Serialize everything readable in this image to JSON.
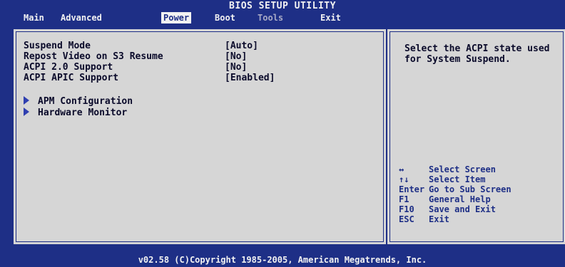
{
  "title": "BIOS SETUP UTILITY",
  "tabs": [
    {
      "label": "Main"
    },
    {
      "label": "Advanced"
    },
    {
      "label": "Power"
    },
    {
      "label": "Boot"
    },
    {
      "label": "Tools"
    },
    {
      "label": "Exit"
    }
  ],
  "active_tab": "Power",
  "settings": [
    {
      "label": "Suspend Mode",
      "value": "[Auto]"
    },
    {
      "label": "Repost Video on S3 Resume",
      "value": "[No]"
    },
    {
      "label": "ACPI 2.0 Support",
      "value": "[No]"
    },
    {
      "label": "ACPI APIC Support",
      "value": "[Enabled]"
    }
  ],
  "submenus": [
    {
      "label": "APM Configuration"
    },
    {
      "label": "Hardware Monitor"
    }
  ],
  "help_text": "Select the ACPI state used for System Suspend.",
  "key_legend": [
    {
      "key": "↔",
      "desc": "Select Screen"
    },
    {
      "key": "↑↓",
      "desc": "Select Item"
    },
    {
      "key": "Enter",
      "desc": "Go to Sub Screen"
    },
    {
      "key": "F1",
      "desc": "General Help"
    },
    {
      "key": "F10",
      "desc": "Save and Exit"
    },
    {
      "key": "ESC",
      "desc": "Exit"
    }
  ],
  "footer": "v02.58 (C)Copyright 1985-2005, American Megatrends, Inc.",
  "colors": {
    "background": "#1e2f86",
    "panel": "#d6d6d6",
    "text": "#0a0a2a",
    "highlight": "#f2f2f2"
  }
}
